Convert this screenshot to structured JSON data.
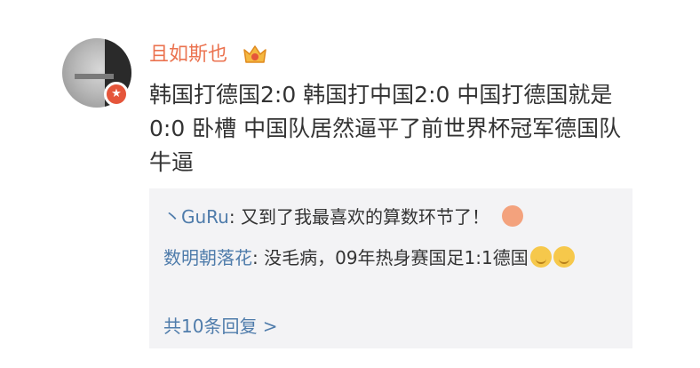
{
  "post": {
    "username": "且如斯也",
    "text": "韩国打德国2:0   韩国打中国2:0    中国打德国就是0:0   卧槽 中国队居然逼平了前世界杯冠军德国队  牛逼"
  },
  "comments": [
    {
      "author": "丶GuRu",
      "text": ": 又到了我最喜欢的算数环节了！"
    },
    {
      "author": "数明朝落花",
      "text": ": 没毛病，09年热身赛国足1:1德国"
    }
  ],
  "replies": {
    "label": "共10条回复 >"
  },
  "colors": {
    "username": "#eb7350",
    "link": "#4f7cab",
    "comment_bg": "#f3f3f5"
  }
}
